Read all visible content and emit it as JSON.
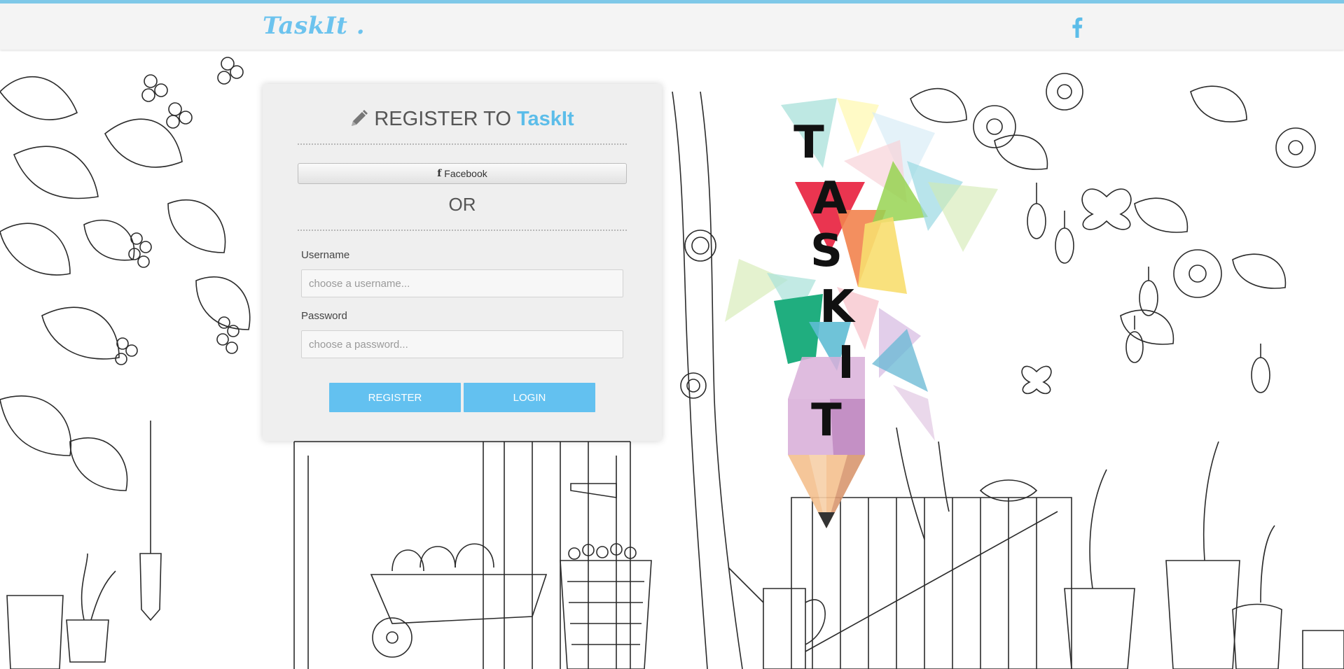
{
  "topbar": {
    "brand": "TaskIt .",
    "facebook_icon": "facebook-icon"
  },
  "register": {
    "title_prefix": "REGISTER TO ",
    "title_brand": "TaskIt",
    "title_icon": "pencil-icon",
    "facebook_button": "Facebook",
    "or_text": "OR",
    "username_label": "Username",
    "username_placeholder": "choose a username...",
    "password_label": "Password",
    "password_placeholder": "choose a password...",
    "register_button": "REGISTER",
    "login_button": "LOGIN"
  },
  "logo": {
    "letters": [
      "T",
      "A",
      "S",
      "K",
      "I",
      "T"
    ]
  },
  "colors": {
    "accent": "#63c1f0",
    "brand": "#6cc3ee",
    "panel_bg": "#efefef",
    "topbar_bg": "#f4f4f4"
  }
}
